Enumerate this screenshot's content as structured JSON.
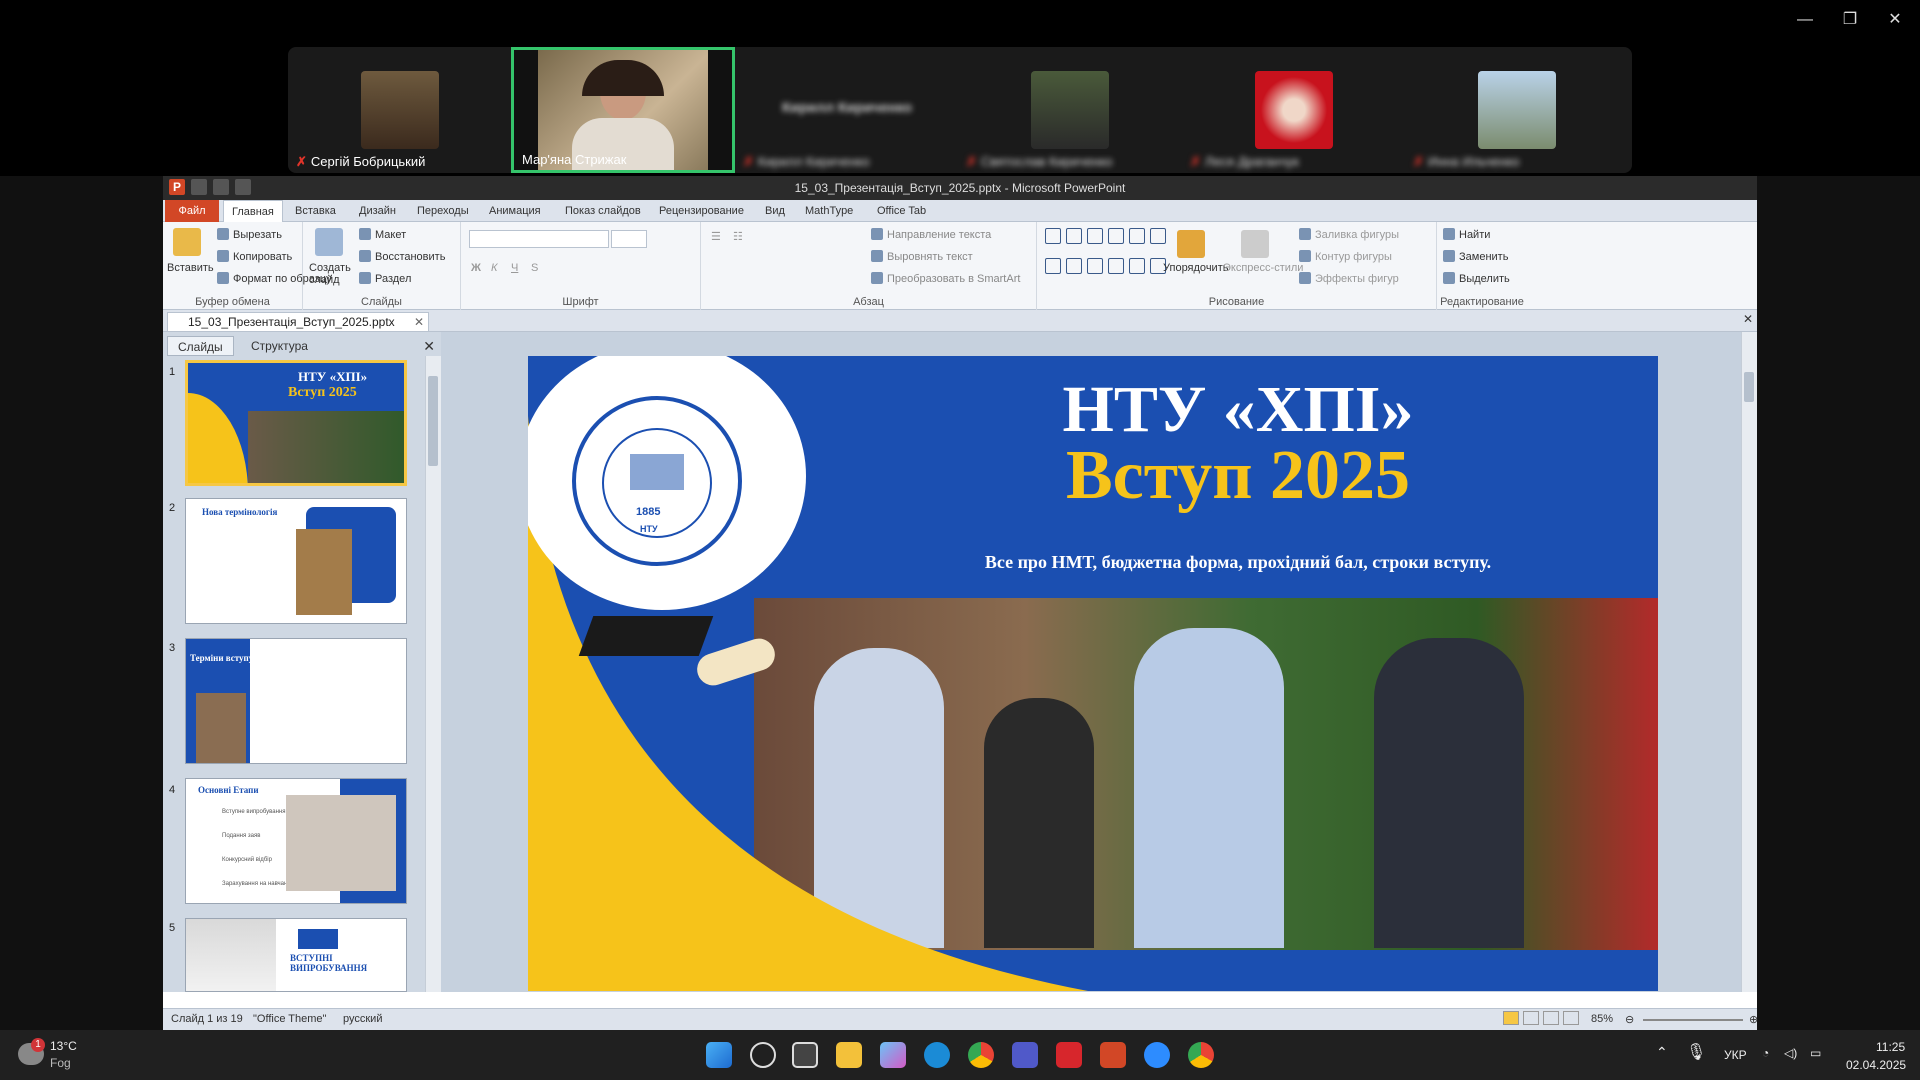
{
  "zoom": {
    "participants": [
      {
        "name": "Сергій Бобрицький",
        "visible": true
      },
      {
        "name": "Мар'яна Стрижак",
        "visible": true,
        "active": true
      },
      {
        "name": "Кирилл Кириченко",
        "blurred": true
      },
      {
        "name": "Святослав Кириченко",
        "blurred": true
      },
      {
        "name": "Леся Драганчук",
        "blurred": true
      },
      {
        "name": "Инна Ильченко",
        "blurred": true
      }
    ],
    "center_blur_name": "Кирилл Кириченко"
  },
  "ppt": {
    "title": "15_03_Презентація_Вступ_2025.pptx - Microsoft PowerPoint",
    "tabs": [
      "Файл",
      "Главная",
      "Вставка",
      "Дизайн",
      "Переходы",
      "Анимация",
      "Показ слайдов",
      "Рецензирование",
      "Вид",
      "MathType",
      "Office Tab"
    ],
    "ribbon": {
      "clipboard": {
        "paste": "Вставить",
        "cut": "Вырезать",
        "copy": "Копировать",
        "format": "Формат по образцу",
        "label": "Буфер обмена"
      },
      "slides": {
        "new": "Создать слайд",
        "layout": "Макет",
        "reset": "Восстановить",
        "section": "Раздел",
        "label": "Слайды"
      },
      "font": {
        "label": "Шрифт"
      },
      "paragraph": {
        "direction": "Направление текста",
        "align": "Выровнять текст",
        "smartart": "Преобразовать в SmartArt",
        "label": "Абзац"
      },
      "drawing": {
        "arrange": "Упорядочить",
        "styles": "Экспресс-стили",
        "fill": "Заливка фигуры",
        "outline": "Контур фигуры",
        "effects": "Эффекты фигур",
        "label": "Рисование"
      },
      "editing": {
        "find": "Найти",
        "replace": "Заменить",
        "select": "Выделить",
        "label": "Редактирование"
      }
    },
    "doc_tab": "15_03_Презентація_Вступ_2025.pptx",
    "pane_tabs": [
      "Слайды",
      "Структура"
    ],
    "thumbs": [
      {
        "num": "1",
        "title": "НТУ «ХПІ»",
        "subtitle": "Вступ 2025"
      },
      {
        "num": "2",
        "title": "Нова термінологія"
      },
      {
        "num": "3",
        "title": "Терміни вступу"
      },
      {
        "num": "4",
        "title": "Основні Етапи",
        "items": [
          "Вступне випробування",
          "Подання заяв",
          "Конкурсний відбір",
          "Зарахування на навчання"
        ]
      },
      {
        "num": "5",
        "title": "ВСТУПНІ ВИПРОБУВАННЯ"
      }
    ],
    "slide": {
      "title": "НТУ «ХПІ»",
      "subtitle": "Вступ 2025",
      "tagline": "Все про НМТ, бюджетна форма, прохідний бал, строки вступу.",
      "logo_year": "1885",
      "logo_text": "ДЕТАЛІ МАШИН ТА ГІДРОПНЕВМОСИСТЕМ",
      "logo_inner": "ХАРКІВСЬКИЙ ПОЛІТЕХНІЧНИЙ ІНСТИТУТ",
      "logo_abbr": "НТУ"
    },
    "status": {
      "slide": "Слайд 1 из 19",
      "theme": "\"Office Theme\"",
      "lang": "русский",
      "zoom": "85%"
    }
  },
  "taskbar": {
    "weather_temp": "13°C",
    "weather_desc": "Fog",
    "weather_badge": "1",
    "lang": "УКР",
    "time": "11:25",
    "date": "02.04.2025"
  },
  "colors": {
    "accent_yellow": "#f6c31a",
    "slide_blue": "#1b4fb1",
    "zoom_green": "#35c46b",
    "ppt_orange": "#d24726"
  }
}
